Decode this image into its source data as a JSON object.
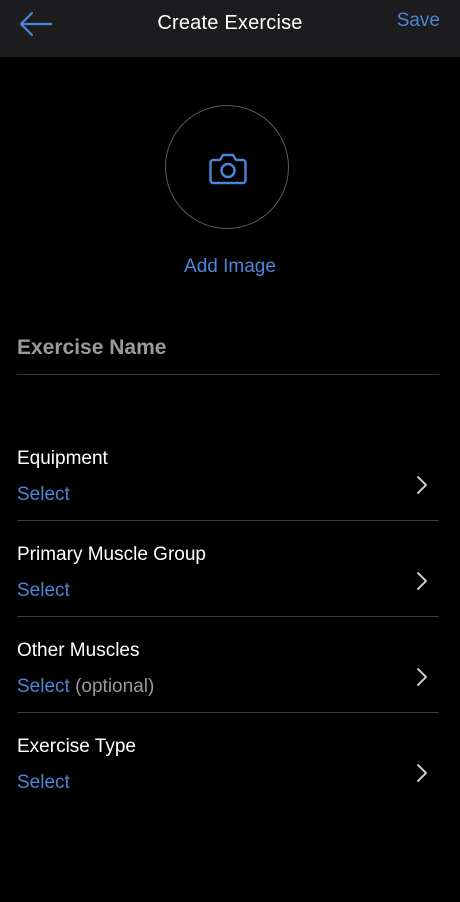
{
  "header": {
    "title": "Create Exercise",
    "back_icon": "arrow-left-icon",
    "save_label": "Save"
  },
  "image_picker": {
    "icon": "camera-icon",
    "add_label": "Add Image"
  },
  "exercise_name": {
    "placeholder": "Exercise Name",
    "value": ""
  },
  "fields": [
    {
      "label": "Equipment",
      "value": "Select",
      "note": ""
    },
    {
      "label": "Primary Muscle Group",
      "value": "Select",
      "note": ""
    },
    {
      "label": "Other Muscles",
      "value": "Select",
      "note": "(optional)"
    },
    {
      "label": "Exercise Type",
      "value": "Select",
      "note": ""
    }
  ],
  "colors": {
    "accent": "#4a86d9",
    "background": "#000000",
    "header_bg": "#1c1c1e",
    "divider": "#3a3a3c",
    "muted": "#9a9a9e"
  }
}
